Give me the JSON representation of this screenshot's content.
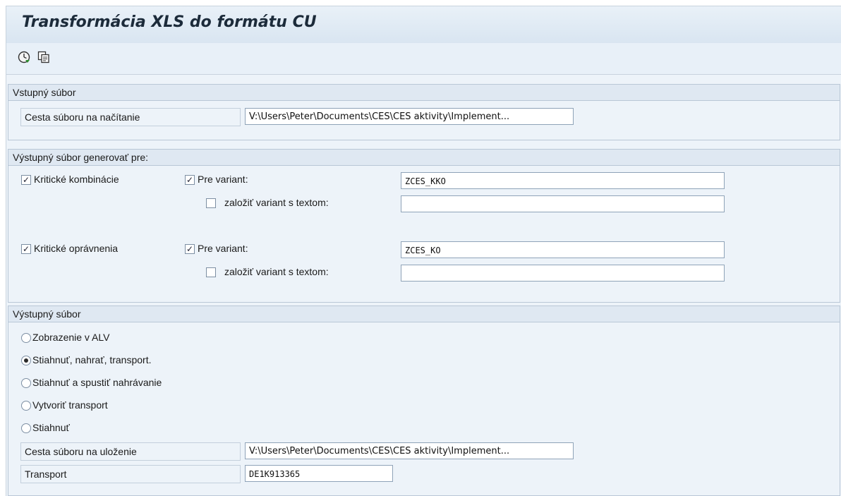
{
  "window": {
    "title": "Transformácia XLS do formátu CU"
  },
  "toolbar": {
    "execute_icon": "execute-icon",
    "variant_icon": "get-variant-icon"
  },
  "input_group": {
    "title": "Vstupný súbor",
    "path_label": "Cesta súboru na načítanie",
    "path_value": "V:\\Users\\Peter\\Documents\\CES\\CES aktivity\\Implement..."
  },
  "generate_group": {
    "title": "Výstupný súbor generovať pre:",
    "critical_combinations": {
      "label": "Kritické kombinácie",
      "checked": true,
      "variant_label": "Pre variant:",
      "variant_checked": true,
      "variant_value": "ZCES_KKO",
      "create_label": "založiť variant s textom:",
      "create_checked": false,
      "create_value": ""
    },
    "critical_authorizations": {
      "label": "Kritické oprávnenia",
      "checked": true,
      "variant_label": "Pre variant:",
      "variant_checked": true,
      "variant_value": "ZCES_KO",
      "create_label": "založiť variant s textom:",
      "create_checked": false,
      "create_value": ""
    }
  },
  "output_group": {
    "title": "Výstupný súbor",
    "options": [
      {
        "label": "Zobrazenie v ALV",
        "selected": false
      },
      {
        "label": "Stiahnuť, nahrať, transport.",
        "selected": true
      },
      {
        "label": "Stiahnuť a spustiť nahrávanie",
        "selected": false
      },
      {
        "label": "Vytvoriť transport",
        "selected": false
      },
      {
        "label": "Stiahnuť",
        "selected": false
      }
    ],
    "save_path_label": "Cesta súboru na uloženie",
    "save_path_value": "V:\\Users\\Peter\\Documents\\CES\\CES aktivity\\Implement...",
    "transport_label": "Transport",
    "transport_value": "DE1K913365"
  }
}
